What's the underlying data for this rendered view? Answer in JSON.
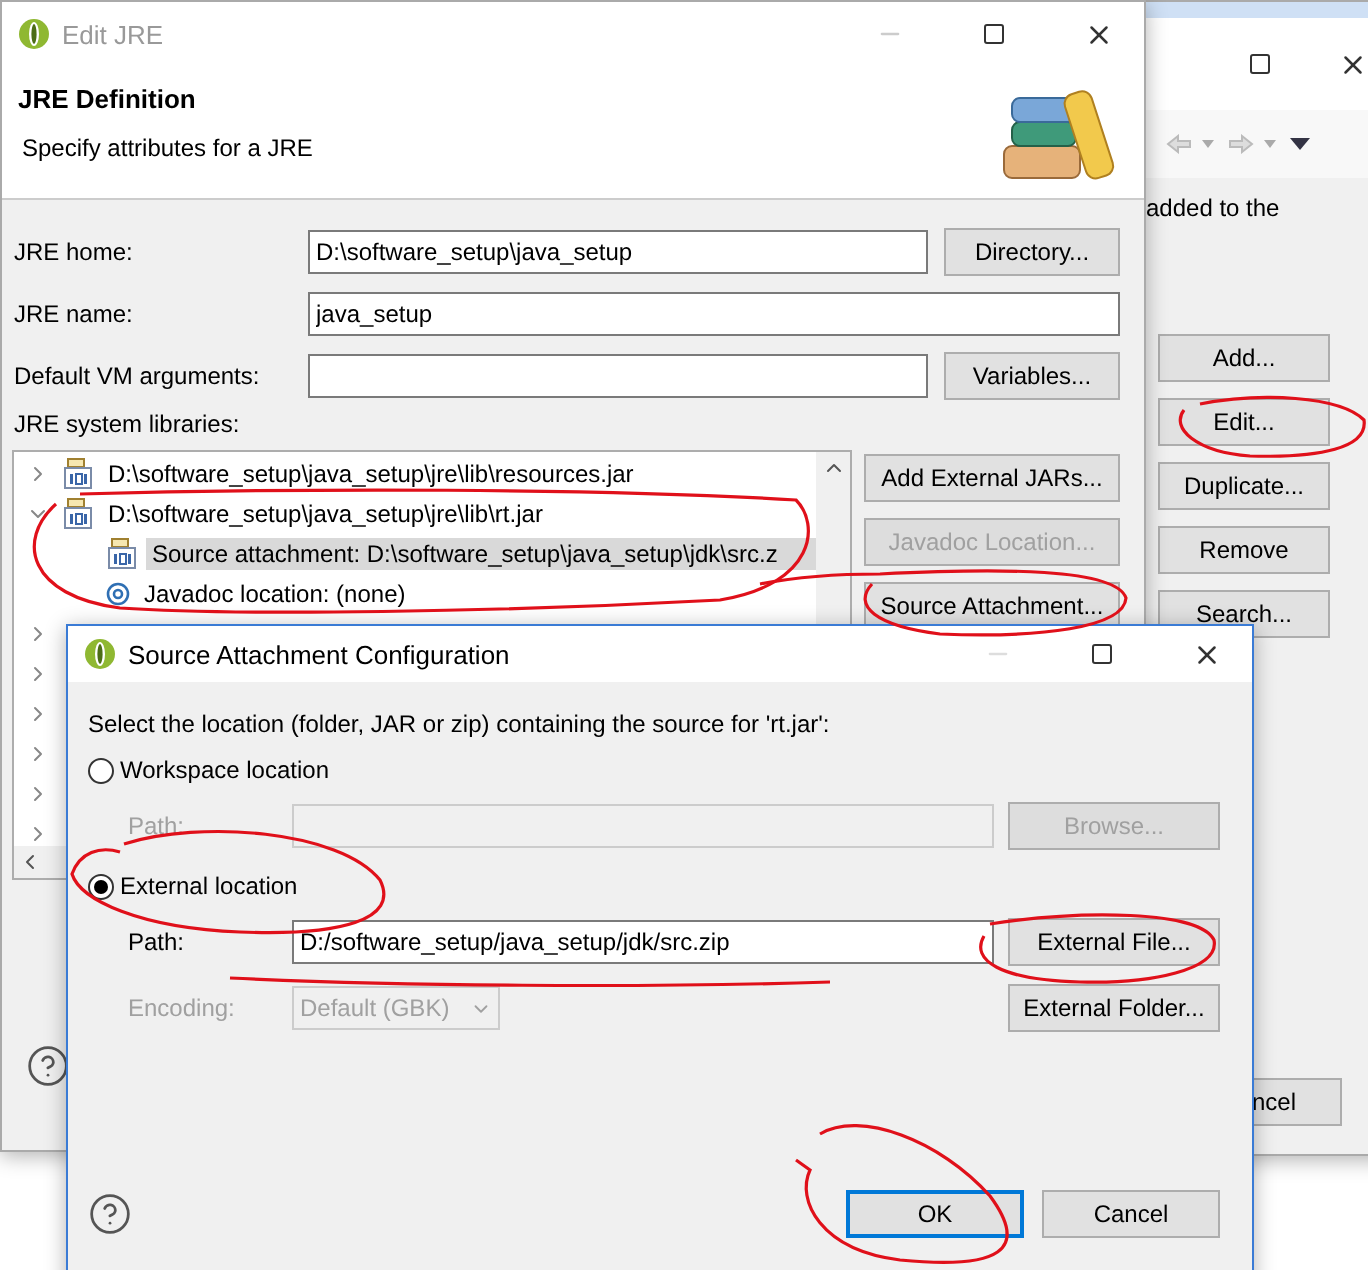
{
  "background_window": {
    "message": "added to the",
    "buttons": [
      {
        "label": "Add..."
      },
      {
        "label": "Edit..."
      },
      {
        "label": "Duplicate..."
      },
      {
        "label": "Remove"
      },
      {
        "label": "Search..."
      }
    ],
    "footer_button": "ncel"
  },
  "edit_jre": {
    "title": "Edit JRE",
    "heading": "JRE Definition",
    "description": "Specify attributes for a JRE",
    "fields": [
      {
        "label": "JRE home:",
        "value": "D:\\software_setup\\java_setup",
        "button": "Directory..."
      },
      {
        "label": "JRE name:",
        "value": "java_setup"
      },
      {
        "label": "Default VM arguments:",
        "button": "Variables..."
      }
    ],
    "libraries_label": "JRE system libraries:",
    "libraries": [
      {
        "kind": "jar",
        "label": "D:\\software_setup\\java_setup\\jre\\lib\\resources.jar",
        "expanded": false,
        "selected": false
      },
      {
        "kind": "jar",
        "label": "D:\\software_setup\\java_setup\\jre\\lib\\rt.jar",
        "expanded": true,
        "selected": false,
        "children": [
          {
            "kind": "source",
            "label": "Source attachment: D:\\software_setup\\java_setup\\jdk\\src.z",
            "selected": true
          },
          {
            "kind": "javadoc",
            "label": "Javadoc location: (none)",
            "selected": false
          }
        ]
      },
      {
        "kind": "jar",
        "expanded": false,
        "selected": false
      },
      {
        "kind": "jar",
        "expanded": false,
        "selected": false
      },
      {
        "kind": "jar",
        "expanded": false,
        "selected": false
      },
      {
        "kind": "jar",
        "expanded": false,
        "selected": false
      },
      {
        "kind": "jar",
        "expanded": false,
        "selected": false
      },
      {
        "kind": "jar",
        "expanded": false,
        "selected": false
      }
    ],
    "library_buttons": [
      {
        "label": "Add External JARs...",
        "disabled": false
      },
      {
        "label": "Javadoc Location...",
        "disabled": true
      },
      {
        "label": "Source Attachment...",
        "disabled": false
      }
    ]
  },
  "dialog": {
    "title": "Source Attachment Configuration",
    "prompt": "Select the location (folder, JAR or zip) containing the source for 'rt.jar':",
    "locations": [
      {
        "label": "Workspace location",
        "selected": false,
        "path_label": "Path:",
        "buttons": [
          "Browse..."
        ]
      },
      {
        "label": "External location",
        "selected": true,
        "path_label": "Path:",
        "path": "D:/software_setup/java_setup/jdk/src.zip",
        "buttons": [
          "External File..."
        ]
      }
    ],
    "encoding_label": "Encoding:",
    "encoding": "Default (GBK)",
    "encoding_disabled": true,
    "encoding_button": "External Folder...",
    "buttons": [
      {
        "label": "OK",
        "default": true
      },
      {
        "label": "Cancel",
        "default": false
      }
    ]
  }
}
